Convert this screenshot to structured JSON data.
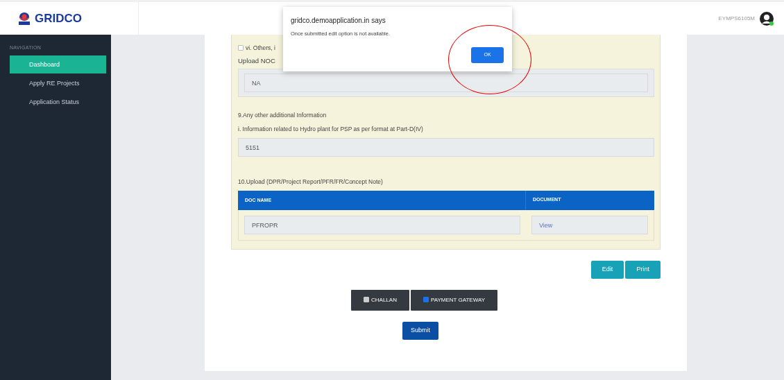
{
  "header": {
    "logo_text": "GRIDCO",
    "username": "EYMPS6105M"
  },
  "sidebar": {
    "heading": "NAVIGATION",
    "items": [
      {
        "label": "Dashboard",
        "selected": true
      },
      {
        "label": "Apply RE Projects",
        "selected": false
      },
      {
        "label": "Application Status",
        "selected": false
      }
    ]
  },
  "form": {
    "others_option": {
      "label": "vi. Others, i",
      "checked": false
    },
    "upload_noc": {
      "label": "Upload NOC",
      "value": "NA"
    },
    "section_9": {
      "heading": "9.Any other additional Information",
      "label": "i. Information related to Hydro plant for PSP as per format at Part-D(IV)",
      "value": "5151"
    },
    "section_10": {
      "heading": "10.Upload (DPR/Project Report/PFR/FR/Concept Note)",
      "columns": [
        "DOC NAME",
        "DOCUMENT"
      ],
      "rows": [
        {
          "doc_name": "PFROPR",
          "document": "View"
        }
      ]
    }
  },
  "actions": [
    "Edit",
    "Print"
  ],
  "payment_options": [
    {
      "label": "CHALLAN",
      "checked": false
    },
    {
      "label": "PAYMENT GATEWAY",
      "checked": true
    }
  ],
  "submit": "Submit",
  "dialog": {
    "title": "gridco.demoapplication.in says",
    "message": "Once submitted edit option is not available.",
    "button": "OK"
  }
}
